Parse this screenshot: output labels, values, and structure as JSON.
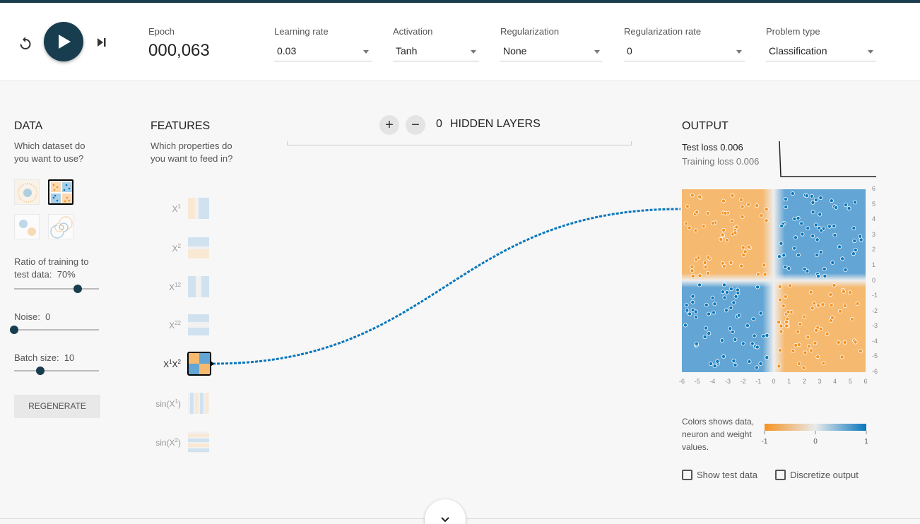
{
  "header": {
    "epoch_label": "Epoch",
    "epoch_value": "000,063",
    "learning_rate": {
      "label": "Learning rate",
      "value": "0.03"
    },
    "activation": {
      "label": "Activation",
      "value": "Tanh"
    },
    "regularization": {
      "label": "Regularization",
      "value": "None"
    },
    "regularization_rate": {
      "label": "Regularization rate",
      "value": "0"
    },
    "problem_type": {
      "label": "Problem type",
      "value": "Classification"
    }
  },
  "data_panel": {
    "title": "DATA",
    "subtitle_1": "Which dataset do",
    "subtitle_2": "you want to use?",
    "ratio_label_1": "Ratio of training to",
    "ratio_label_2": "test data:",
    "ratio_value": "70%",
    "ratio_fraction": 0.75,
    "noise_label": "Noise:",
    "noise_value": "0",
    "noise_fraction": 0,
    "batch_label": "Batch size:",
    "batch_value": "10",
    "batch_fraction": 0.31,
    "regenerate_label": "REGENERATE"
  },
  "features_panel": {
    "title": "FEATURES",
    "subtitle_1": "Which properties do",
    "subtitle_2": "you want to feed in?",
    "features": [
      {
        "base": "X",
        "sup": "1",
        "tail": "",
        "tail_sup": "",
        "active": false
      },
      {
        "base": "X",
        "sup": "2",
        "tail": "",
        "tail_sup": "",
        "active": false
      },
      {
        "base": "X",
        "sup": "12",
        "tail": "",
        "tail_sup": "",
        "active": false
      },
      {
        "base": "X",
        "sup": "22",
        "tail": "",
        "tail_sup": "",
        "active": false
      },
      {
        "base": "X",
        "sup": "1",
        "tail": "X",
        "tail_sup": "2",
        "active": true
      },
      {
        "base": "sin(X",
        "sup": "1",
        "tail": ")",
        "tail_sup": "",
        "active": false
      },
      {
        "base": "sin(X",
        "sup": "2",
        "tail": ")",
        "tail_sup": "",
        "active": false
      }
    ]
  },
  "hidden_layers": {
    "add_symbol": "+",
    "remove_symbol": "−",
    "count": "0",
    "label": "HIDDEN LAYERS"
  },
  "output_panel": {
    "title": "OUTPUT",
    "test_loss_label": "Test loss",
    "test_loss_value": "0.006",
    "training_loss_label": "Training loss",
    "training_loss_value": "0.006",
    "legend_text": "Colors shows data, neuron and weight values.",
    "legend_ticks": [
      "-1",
      "0",
      "1"
    ],
    "axis_ticks": [
      "-6",
      "-5",
      "-4",
      "-3",
      "-2",
      "-1",
      "0",
      "1",
      "2",
      "3",
      "4",
      "5",
      "6"
    ],
    "show_test_data_label": "Show test data",
    "discretize_label": "Discretize output"
  },
  "colors": {
    "orange": "#f59322",
    "blue": "#0877bd",
    "dark": "#183d4e",
    "orange_light": "#f5b970",
    "blue_light": "#63a5d4"
  }
}
